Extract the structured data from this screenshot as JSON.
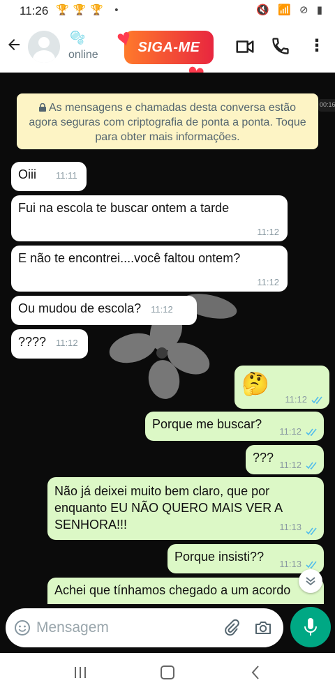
{
  "status_bar": {
    "time": "11:26",
    "notif_icons": "🏆🏆🏆 •",
    "system_icons": "🔇 📶 ⊘ ▮"
  },
  "header": {
    "contact_emoji": "🫧",
    "contact_status": "online",
    "badge_text": "SIGA-ME",
    "menu_glyph": "⋮"
  },
  "chat": {
    "encryption_notice": "As mensagens e chamadas desta conversa estão agora seguras com criptografia de ponta a ponta. Toque para obter mais informações.",
    "video_time_pill": "00:16",
    "messages": [
      {
        "direction": "in",
        "text": "Oiii",
        "time": "11:11"
      },
      {
        "direction": "in",
        "text": "Fui na escola te buscar ontem a tarde",
        "time": "11:12"
      },
      {
        "direction": "in",
        "text": "E não te encontrei....você faltou ontem?",
        "time": "11:12"
      },
      {
        "direction": "in",
        "text": "Ou mudou de escola?",
        "time": "11:12"
      },
      {
        "direction": "in",
        "text": "????",
        "time": "11:12"
      },
      {
        "direction": "out",
        "text": "🤔",
        "time": "11:12"
      },
      {
        "direction": "out",
        "text": "Porque me buscar?",
        "time": "11:12"
      },
      {
        "direction": "out",
        "text": "???",
        "time": "11:12"
      },
      {
        "direction": "out",
        "text": "Não já deixei muito bem claro, que por enquanto EU NÃO QUERO MAIS VER A SENHORA!!!",
        "time": "11:13"
      },
      {
        "direction": "out",
        "text": "Porque insisti??",
        "time": "11:13"
      },
      {
        "direction": "out",
        "text": "Achei que tínhamos chegado a um acordo"
      }
    ]
  },
  "composer": {
    "placeholder": "Mensagem"
  },
  "colors": {
    "incoming": "#ffffff",
    "outgoing": "#dcf8c6",
    "accent": "#00a884",
    "banner": "#fdf4c5",
    "read_ticks": "#53bdeb"
  },
  "icons": [
    "back-arrow-icon",
    "avatar",
    "video-call-icon",
    "phone-icon",
    "menu-icon",
    "lock-icon",
    "double-check-icon",
    "scroll-down-icon",
    "emoji-icon",
    "paperclip-icon",
    "camera-icon",
    "mic-icon",
    "nav-recents-icon",
    "nav-home-icon",
    "nav-back-icon"
  ]
}
